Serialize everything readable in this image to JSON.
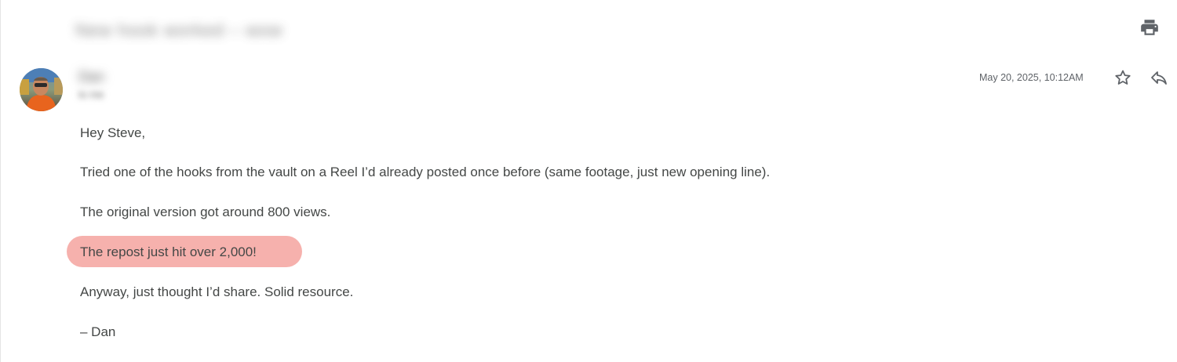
{
  "header": {
    "subject": "New hook worked – wow"
  },
  "sender": {
    "name": "Dan",
    "to": "to me"
  },
  "meta": {
    "timestamp": "May 20, 2025, 10:12AM"
  },
  "message": {
    "greeting": "Hey Steve,",
    "line1": "Tried one of the hooks from the vault on a Reel I’d already posted once before (same footage, just new opening line).",
    "line2": "The original version got around 800 views.",
    "highlight_line": "The repost just hit over 2,000!",
    "line4": "Anyway, just thought I’d share. Solid resource.",
    "signoff": "– Dan"
  },
  "colors": {
    "highlight": "#f6b1ad",
    "text": "#444746",
    "muted": "#5f6368"
  },
  "icons": {
    "print": "print-icon",
    "star": "star-icon",
    "reply": "reply-icon"
  }
}
